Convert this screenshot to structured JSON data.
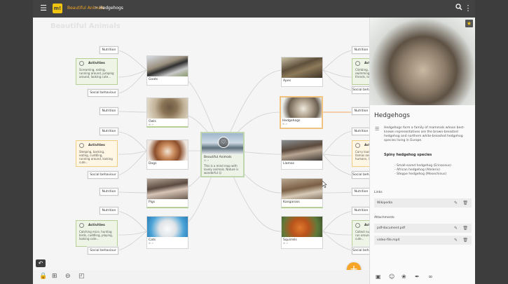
{
  "breadcrumb": {
    "root": "Beautiful Animals",
    "separator": ">",
    "current": "Hedgehogs"
  },
  "icons": {
    "menu": "menu-icon",
    "logo": "m!",
    "search": "search-icon",
    "more": "more-vert-icon"
  },
  "logo_text": "m!",
  "map": {
    "title": "Beautiful Animals",
    "center": {
      "name": "Beautiful Animals",
      "counts": "✉ ↗",
      "description": "This is a mind map with lovely animals. Nature is wonderful ☺"
    },
    "label_nutrition": "Nutrition",
    "label_social": "Social behaviour",
    "activity_title": "Activities",
    "nodes": {
      "goats": {
        "name": "Goats"
      },
      "owls": {
        "name": "Owls",
        "counts": "✉ ↗"
      },
      "dogs": {
        "name": "Dogs"
      },
      "pigs": {
        "name": "Pigs"
      },
      "cats": {
        "name": "Cats",
        "counts": "✉ ↗"
      },
      "apes": {
        "name": "Apes"
      },
      "hedgehogs": {
        "name": "Hedgehogs",
        "counts": "✉ ↗"
      },
      "llamas": {
        "name": "Llamas"
      },
      "kangaroos": {
        "name": "Kangaroos"
      },
      "squirrels": {
        "name": "Squirrels",
        "counts": "✉ ↗"
      }
    },
    "activities": {
      "goats": "Screaming, eating, running around, jumping around, looking cute...",
      "dogs": "Sleeping, barking, eating, cuddling, running around, looking cute...",
      "cats": "Catching mice, hunting birds, cuddling, playing, looking cute...",
      "apes": "Climbing, jumping, swimming, playing friends, looking cute...",
      "llamas": "Carry loads, spit at other llamas and sometimes humans, looking cute...",
      "squirrels": "Collect nuts, hide nuts, run around fast, looking cute..."
    }
  },
  "panel": {
    "title": "Hedgehogs",
    "description": "Hedgehogs form a family of mammals whose best-known representatives are the brown-breasted hedgehog and northern white-breasted hedgehog species living in Europe.",
    "subheading": "Spiny hedgehog species",
    "species": [
      "- Small-eared hedgehog (Erinaceus)",
      "- African hedgehog (Atelerix)",
      "- Steppe hedgehog (Mesechinus)"
    ],
    "links_label": "Links",
    "links": [
      "Wikipedia"
    ],
    "attachments_label": "Attachments",
    "attachments": [
      "pdf-document.pdf",
      "video-file.mp4"
    ]
  },
  "colors": {
    "accent": "#f7a527",
    "green": "#b5cf95",
    "yellow": "#f0cd83",
    "topbar": "#424242"
  }
}
